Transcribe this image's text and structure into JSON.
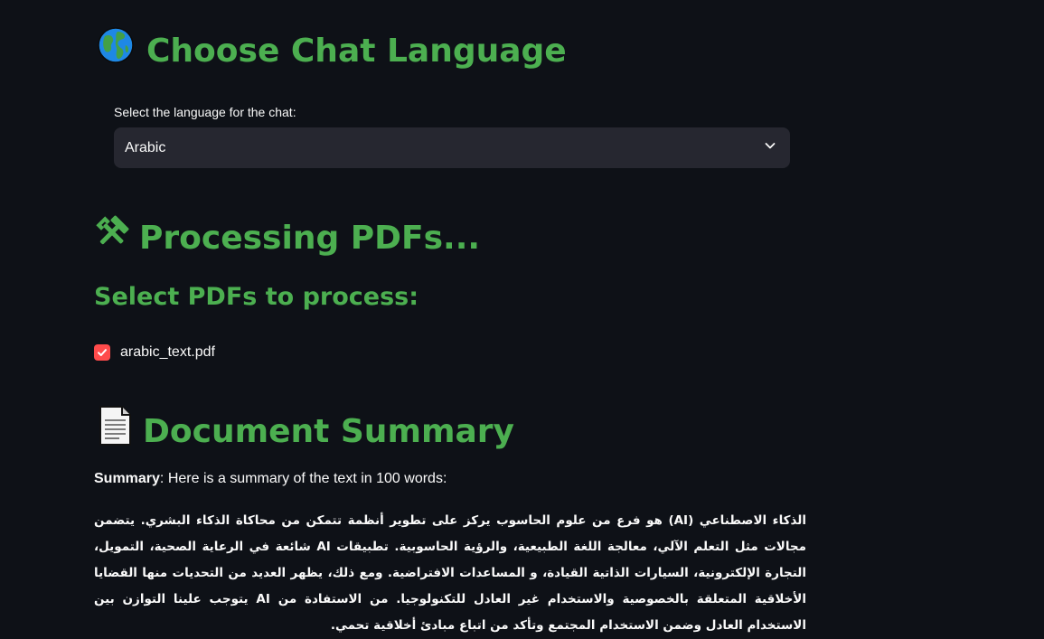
{
  "language_section": {
    "heading": "Choose Chat Language",
    "heading_icon": "globe-icon",
    "select_label": "Select the language for the chat:",
    "selected_value": "Arabic"
  },
  "processing_section": {
    "heading": "Processing PDFs...",
    "heading_icon": "hammer-wrench-icon",
    "subheading": "Select PDFs to process:",
    "files": [
      {
        "name": "arabic_text.pdf",
        "checked": true
      }
    ]
  },
  "summary_section": {
    "heading": "Document Summary",
    "heading_icon": "page-icon",
    "label_bold": "Summary",
    "label_rest": ": Here is a summary of the text in 100 words:",
    "arabic_text": "الذكاء الاصطناعي (AI) هو فرع من علوم الحاسوب يركز على تطوير أنظمة تتمكن من محاكاة الذكاء البشري. يتضمن مجالات مثل التعلم الآلي، معالجة اللغة الطبيعية، والرؤية الحاسوبية. تطبيقات AI شائعة في الرعاية الصحية، التمويل، التجارة الإلكترونية، السيارات الذاتية القيادة، و المساعدات الافتراضية. ومع ذلك، يظهر العديد من التحديات منها القضايا الأخلاقية المتعلقة بالخصوصية والاستخدام غير العادل للتكنولوجيا. من الاستفادة من AI يتوجب علينا التوازن بين الاستخدام العادل وضمن الاستخدام المجتمع وتأكد من اتباع مبادئ أخلاقية تحمي."
  },
  "colors": {
    "background": "#0e1117",
    "heading": "#4caf50",
    "select_bg": "#262730",
    "checkbox": "#ff4b4b",
    "text": "#fafafa"
  }
}
